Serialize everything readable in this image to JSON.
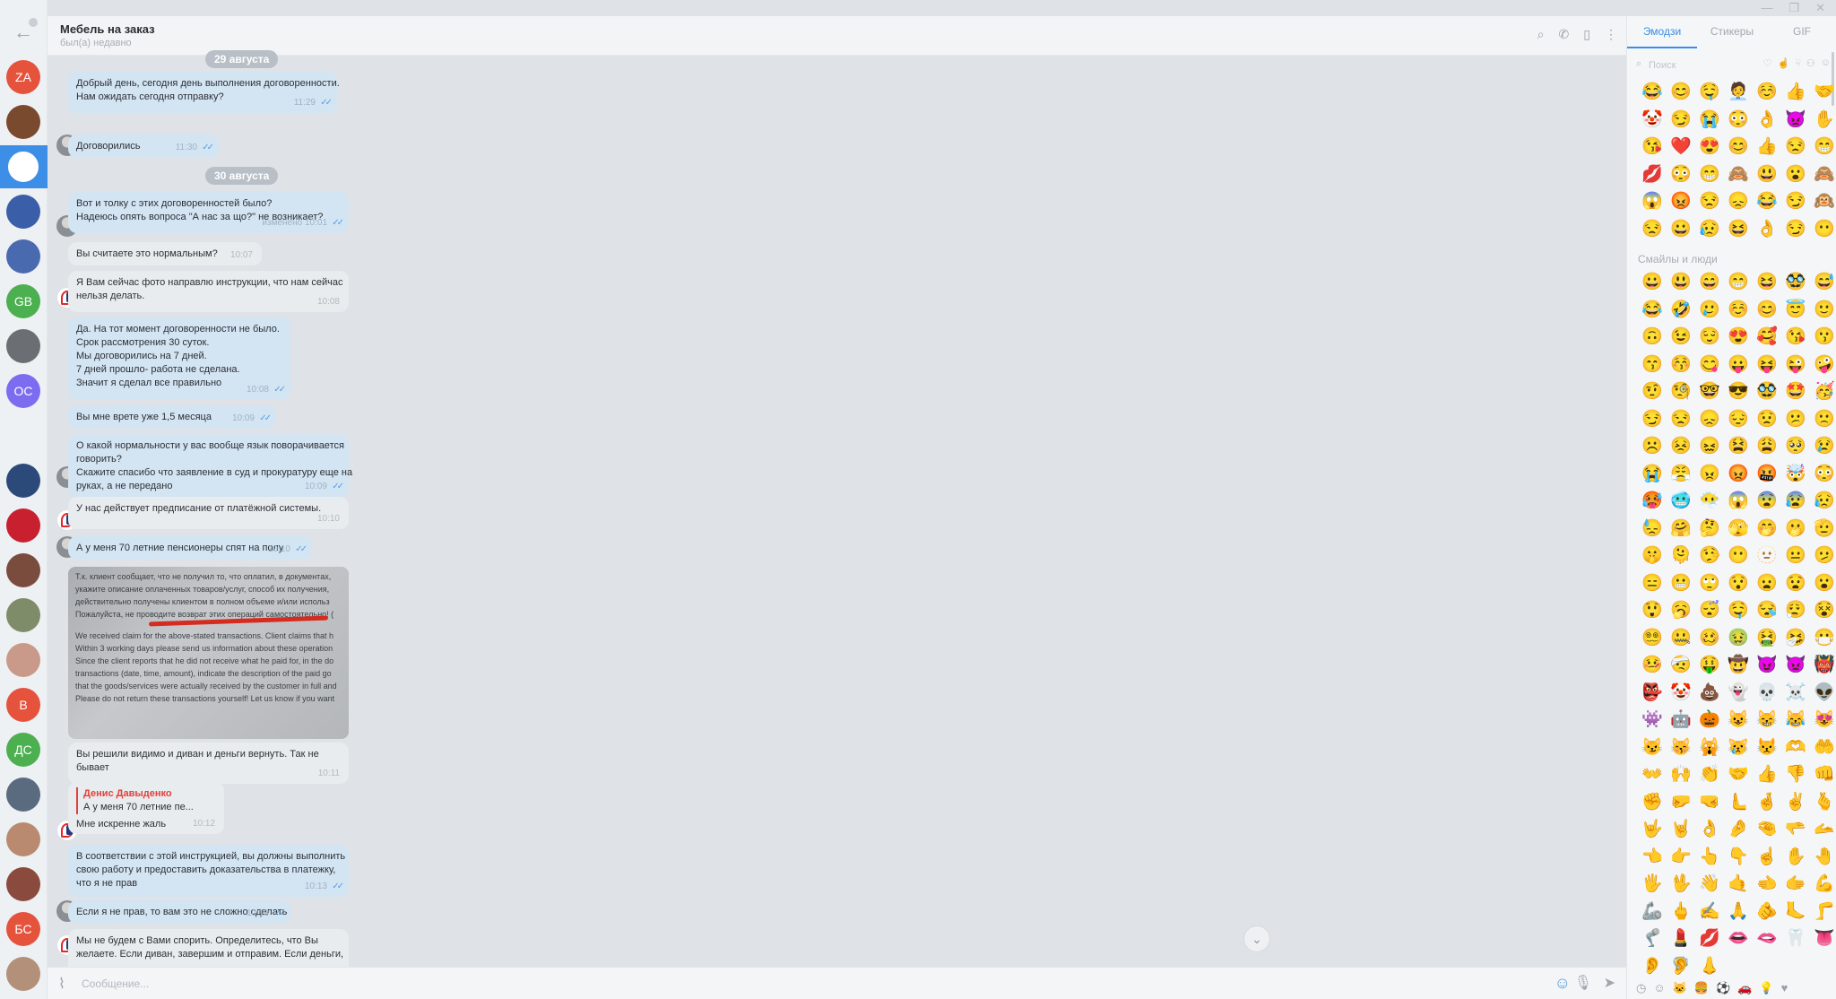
{
  "window": {
    "controls": [
      "—",
      "❐",
      "✕"
    ]
  },
  "chatlist": {
    "items": [
      {
        "label": "ZA",
        "color": "#e5533d"
      },
      {
        "label": "",
        "color": "#7a4a2e"
      },
      {
        "label": "",
        "color": "#ffffff"
      },
      {
        "label": "",
        "color": "#3b5ea8"
      },
      {
        "label": "",
        "color": "#4a6ab0"
      },
      {
        "label": "GB",
        "color": "#4caf50"
      },
      {
        "label": "",
        "color": "#6b6f74"
      },
      {
        "label": "OC",
        "color": "#7c6cf0"
      },
      {
        "label": "",
        "color": "#eef1f4"
      },
      {
        "label": "",
        "color": "#2b4a7a"
      },
      {
        "label": "",
        "color": "#c8202f"
      },
      {
        "label": "",
        "color": "#7a4c3e"
      },
      {
        "label": "",
        "color": "#7e8c6a"
      },
      {
        "label": "",
        "color": "#c99a8a"
      },
      {
        "label": "B",
        "color": "#e5533d"
      },
      {
        "label": "ДС",
        "color": "#4caf50"
      },
      {
        "label": "",
        "color": "#5a6b80"
      },
      {
        "label": "",
        "color": "#b98a70"
      },
      {
        "label": "",
        "color": "#8a4b3e"
      },
      {
        "label": "БС",
        "color": "#e5533d"
      },
      {
        "label": "",
        "color": "#b3907a"
      }
    ]
  },
  "header": {
    "title": "Мебель на заказ",
    "status": "был(а) недавно",
    "icons": [
      "search-icon",
      "phone-icon",
      "sidebar-icon",
      "more-icon"
    ]
  },
  "messages": {
    "date1": "29 августа",
    "date2": "30 августа",
    "m1": {
      "lines": [
        "Добрый день, сегодня день выполнения договоренности.",
        "Нам ожидать сегодня отправку?"
      ],
      "time": "11:29"
    },
    "m2": {
      "lines": [
        "Договорились"
      ],
      "time": "11:30"
    },
    "m3": {
      "lines": [
        "Вот и толку с этих договоренностей было?",
        "Надеюсь опять вопроса \"А нас за що?\" не возникает?"
      ],
      "time": "изменено 10:01"
    },
    "m4": {
      "lines": [
        "Вы считаете это нормальным?"
      ],
      "time": "10:07"
    },
    "m5": {
      "lines": [
        "Я Вам сейчас фото направлю инструкции, что нам сейчас",
        "нельзя делать."
      ],
      "time": "10:08"
    },
    "m6": {
      "lines": [
        "Да. На тот момент договоренности не было.",
        "Срок рассмотрения 30 суток.",
        "Мы договорились на 7 дней.",
        "7 дней прошло- работа не сделана.",
        "Значит я сделал все правильно"
      ],
      "time": "10:08"
    },
    "m7": {
      "lines": [
        "Вы мне врете уже 1,5 месяца"
      ],
      "time": "10:09"
    },
    "m8": {
      "lines": [
        "О какой нормальности у вас вообще язык поворачивается",
        "говорить?",
        "Скажите спасибо что заявление в суд и прокуратуру еще на",
        "руках, а не передано"
      ],
      "time": "10:09"
    },
    "m9": {
      "lines": [
        "У нас действует предписание от платёжной системы."
      ],
      "time": "10:10"
    },
    "m10": {
      "lines": [
        "А у меня 70 летние пенсионеры спят на полу"
      ],
      "time": "10:10"
    },
    "photo": {
      "lines": [
        "Т.к. клиент сообщает, что не получил то, что оплатил, в документах,",
        "укажите описание оплаченных товаров/услуг, способ их получения,",
        "действительно получены клиентом в полном объеме и/или использ",
        "Пожалуйста, не проводите возврат этих операций самостоятельно! (",
        "",
        "We received claim for the above-stated transactions. Client claims that h",
        "Within 3 working days please send us information about these operation",
        "Since the client reports that he did not receive what he paid for, in the do",
        "transactions (date, time, amount), indicate the description of the paid go",
        "that the goods/services were actually received by the customer in full and",
        "Please do not return these transactions yourself! Let us know if you want"
      ]
    },
    "m11": {
      "lines": [
        "Вы решили видимо и диван и деньги вернуть. Так не",
        "бывает"
      ],
      "time": "10:11"
    },
    "m12": {
      "quote_name": "Денис Давыденко",
      "quote_text": "А у меня 70 летние пе...",
      "lines": [
        "Мне искренне жаль"
      ],
      "time": "10:12"
    },
    "m13": {
      "lines": [
        "В соответствии с этой инструкцией, вы должны выполнить",
        "свою работу и предоставить доказательства в платежку,",
        "что я не прав"
      ],
      "time": "10:13"
    },
    "m14": {
      "lines": [
        "Если я не прав, то вам это не сложно сделать"
      ],
      "time": "10:13"
    },
    "m15": {
      "lines": [
        "Мы не будем с Вами спорить. Определитесь, что Вы",
        "желаете. Если диван, завершим и отправим. Если деньги,"
      ]
    }
  },
  "composer": {
    "placeholder": "Сообщение..."
  },
  "emoji_panel": {
    "tabs": [
      "Эмодзи",
      "Стикеры",
      "GIF"
    ],
    "search_placeholder": "Поиск",
    "section_title": "Смайлы и люди",
    "recent": [
      "😂",
      "😊",
      "🤤",
      "🧑‍💼",
      "☺️",
      "👍",
      "🤝",
      "🤡",
      "😏",
      "😭",
      "😳",
      "👌",
      "👿",
      "✋",
      "😘",
      "❤️",
      "😍",
      "😊",
      "👍",
      "😒",
      "😁",
      "💋",
      "😳",
      "😁",
      "🙈",
      "😃",
      "😮",
      "🙈",
      "😱",
      "😡",
      "😒",
      "😞",
      "😂",
      "😏",
      "🙉",
      "😒",
      "😀",
      "😥",
      "😆",
      "👌",
      "😏",
      "😶"
    ],
    "smileys": [
      "😀",
      "😃",
      "😄",
      "😁",
      "😆",
      "🥸",
      "😅",
      "😂",
      "🤣",
      "🥲",
      "☺️",
      "😊",
      "😇",
      "🙂",
      "🙃",
      "😉",
      "😌",
      "😍",
      "🥰",
      "😘",
      "😗",
      "😙",
      "😚",
      "😋",
      "😛",
      "😝",
      "😜",
      "🤪",
      "🤨",
      "🧐",
      "🤓",
      "😎",
      "🥸",
      "🤩",
      "🥳",
      "😏",
      "😒",
      "😞",
      "😔",
      "😟",
      "😕",
      "🙁",
      "☹️",
      "😣",
      "😖",
      "😫",
      "😩",
      "🥺",
      "😢",
      "😭",
      "😤",
      "😠",
      "😡",
      "🤬",
      "🤯",
      "😳",
      "🥵",
      "🥶",
      "😶‍🌫️",
      "😱",
      "😨",
      "😰",
      "😥",
      "😓",
      "🤗",
      "🤔",
      "🫣",
      "🤭",
      "🫢",
      "🫡",
      "🤫",
      "🫠",
      "🤥",
      "😶",
      "🫥",
      "😐",
      "🫤",
      "😑",
      "😬",
      "🙄",
      "😯",
      "😦",
      "😧",
      "😮",
      "😲",
      "🥱",
      "😴",
      "🤤",
      "😪",
      "😮‍💨",
      "😵",
      "😵‍💫",
      "🤐",
      "🥴",
      "🤢",
      "🤮",
      "🤧",
      "😷",
      "🤒",
      "🤕",
      "🤑",
      "🤠",
      "😈",
      "👿",
      "👹",
      "👺",
      "🤡",
      "💩",
      "👻",
      "💀",
      "☠️",
      "👽",
      "👾",
      "🤖",
      "🎃",
      "😺",
      "😸",
      "😹",
      "😻",
      "😼",
      "😽",
      "🙀",
      "😿",
      "😾",
      "🫶",
      "🤲",
      "👐",
      "🙌",
      "👏",
      "🤝",
      "👍",
      "👎",
      "👊",
      "✊",
      "🤛",
      "🤜",
      "🫷",
      "🤞",
      "✌️",
      "🫰",
      "🤟",
      "🤘",
      "👌",
      "🤌",
      "🤏",
      "🫳",
      "🫴",
      "👈",
      "👉",
      "👆",
      "👇",
      "☝️",
      "✋",
      "🤚",
      "🖐️",
      "🖖",
      "👋",
      "🤙",
      "🫲",
      "🫱",
      "💪",
      "🦾",
      "🖕",
      "✍️",
      "🙏",
      "🫵",
      "🦶",
      "🦵",
      "🦿",
      "💄",
      "💋",
      "👄",
      "🫦",
      "🦷",
      "👅",
      "👂",
      "🦻",
      "👃"
    ]
  }
}
